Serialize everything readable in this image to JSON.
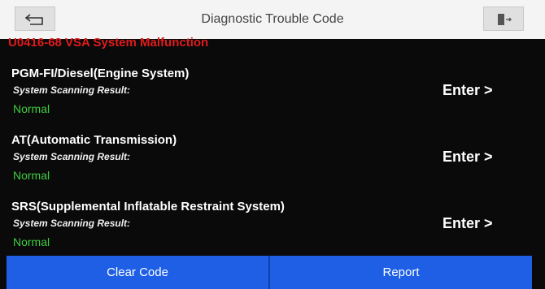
{
  "header": {
    "title": "Diagnostic Trouble Code",
    "back_icon": "back-arrow-icon",
    "exit_icon": "exit-door-icon"
  },
  "dtc": {
    "code_text": "U0416-68 VSA System Malfunction",
    "color": "#e01b1b"
  },
  "systems": [
    {
      "name": "PGM-FI/Diesel(Engine System)",
      "scan_label": "System Scanning Result:",
      "status": "Normal",
      "enter_label": "Enter >"
    },
    {
      "name": "AT(Automatic Transmission)",
      "scan_label": "System Scanning Result:",
      "status": "Normal",
      "enter_label": "Enter >"
    },
    {
      "name": "SRS(Supplemental Inflatable Restraint System)",
      "scan_label": "System Scanning Result:",
      "status": "Normal",
      "enter_label": "Enter >"
    }
  ],
  "footer": {
    "clear_label": "Clear Code",
    "report_label": "Report"
  },
  "colors": {
    "accent": "#1e5fe6",
    "status_normal": "#3fce3f",
    "error": "#e01b1b"
  }
}
